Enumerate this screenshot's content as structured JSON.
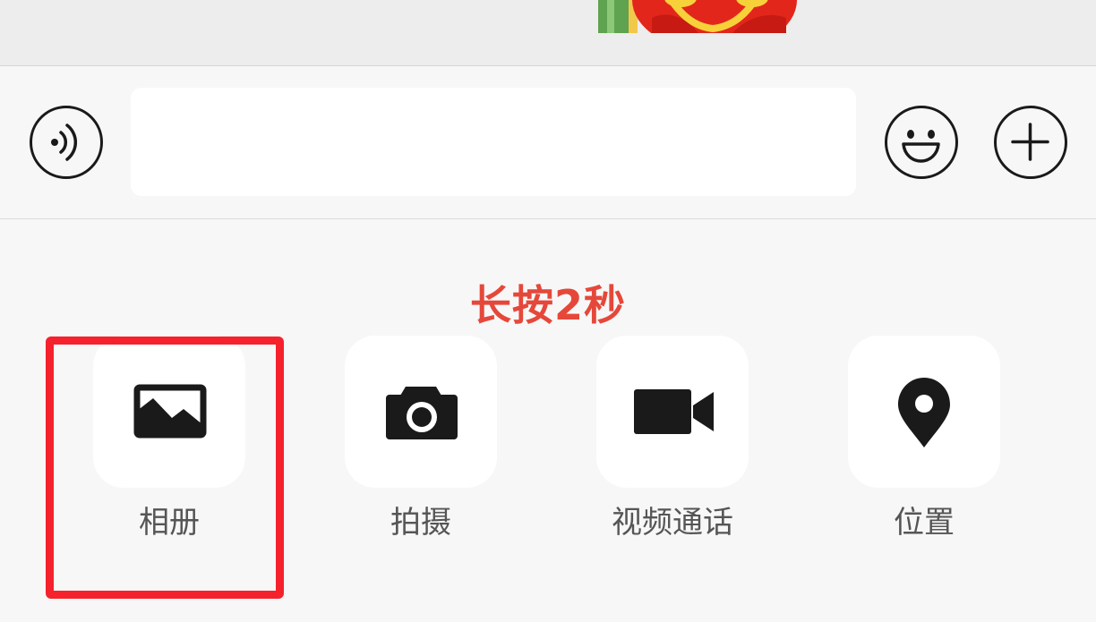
{
  "input_bar": {
    "voice_icon": "voice-wave-icon",
    "message_input_value": "",
    "emoji_icon": "smiley-icon",
    "plus_icon": "plus-icon"
  },
  "panel": {
    "hint_text": "长按2秒",
    "hint_color": "#e5483a",
    "highlight_color": "#f5222d",
    "actions": [
      {
        "label": "相册",
        "icon": "photo-album-icon"
      },
      {
        "label": "拍摄",
        "icon": "camera-icon"
      },
      {
        "label": "视频通话",
        "icon": "video-call-icon"
      },
      {
        "label": "位置",
        "icon": "location-pin-icon"
      }
    ]
  }
}
